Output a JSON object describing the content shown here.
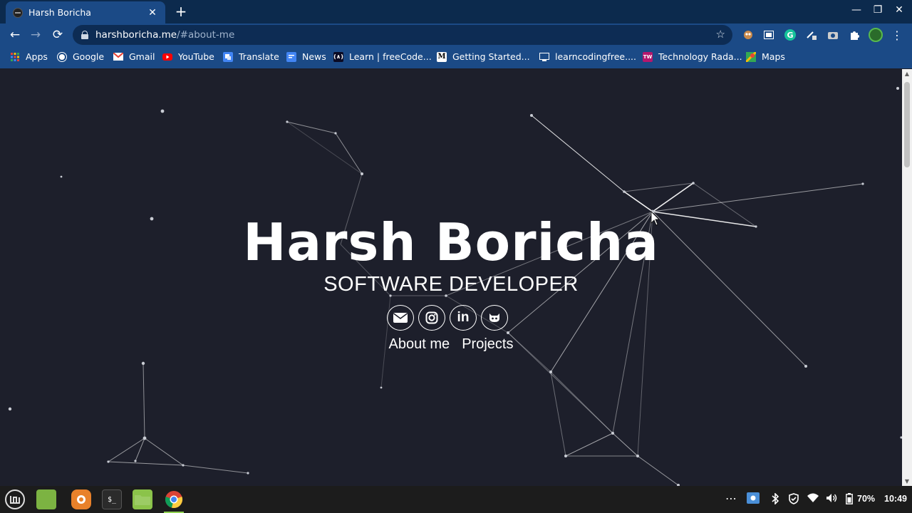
{
  "browser": {
    "tab": {
      "title": "Harsh Boricha",
      "close": "✕"
    },
    "new_tab": "+",
    "window_controls": {
      "minimize": "—",
      "restore": "❐",
      "close": "✕"
    },
    "nav": {
      "back": "←",
      "forward": "→",
      "reload": "⟳"
    },
    "address": {
      "host": "harshboricha.me",
      "path": "/#about-me"
    },
    "star": "☆",
    "extensions": [
      "puzzle-icon",
      "grammarly-icon",
      "pencil-icon",
      "camera-icon"
    ],
    "grammarly_letter": "G",
    "menu": "⋮"
  },
  "bookmarks": [
    {
      "label": "Apps",
      "icon": "apps-grid-icon"
    },
    {
      "label": "Google",
      "icon": "google-icon"
    },
    {
      "label": "Gmail",
      "icon": "gmail-icon"
    },
    {
      "label": "YouTube",
      "icon": "youtube-icon"
    },
    {
      "label": "Translate",
      "icon": "translate-icon"
    },
    {
      "label": "News",
      "icon": "news-icon"
    },
    {
      "label": "Learn | freeCode...",
      "icon": "freecodecamp-icon"
    },
    {
      "label": "Getting Started...",
      "icon": "medium-icon"
    },
    {
      "label": "learncodingfree....",
      "icon": "learncoding-icon"
    },
    {
      "label": "Technology Rada...",
      "icon": "thoughtworks-icon"
    },
    {
      "label": "Maps",
      "icon": "maps-icon"
    }
  ],
  "bookmark_glyphs": {
    "freecodecamp": "(∧)",
    "medium": "M",
    "thoughtworks": "TW"
  },
  "page": {
    "title": "Harsh Boricha",
    "subtitle": "SOFTWARE DEVELOPER",
    "socials": [
      {
        "name": "email",
        "glyph": "✉"
      },
      {
        "name": "instagram",
        "glyph": "◎"
      },
      {
        "name": "linkedin",
        "glyph": "in"
      },
      {
        "name": "github",
        "glyph": "◉"
      }
    ],
    "links": [
      "About me",
      "Projects"
    ]
  },
  "taskbar": {
    "apps": [
      "mint-menu-icon",
      "desktop-icon",
      "firefox-icon",
      "terminal-icon",
      "files-icon",
      "chrome-icon"
    ],
    "terminal_glyph": "$_",
    "tray": {
      "more": "⋯",
      "battery": "70%",
      "time": "10:49"
    }
  },
  "colors": {
    "page_bg": "#1d1f2b",
    "chrome_bar": "#1b4a86",
    "tab_strip": "#0c2a4d",
    "taskbar": "#1c1c1c"
  }
}
